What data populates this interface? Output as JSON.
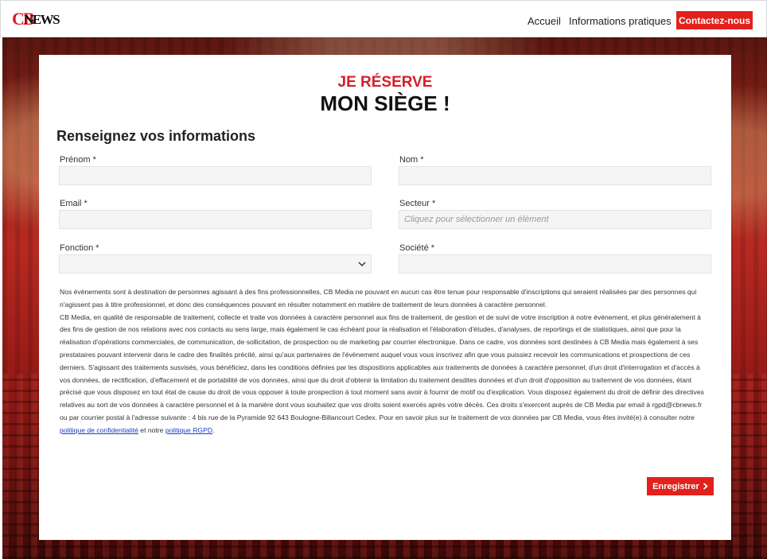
{
  "header": {
    "logo_cb": "CB",
    "logo_news": "NEWS",
    "nav": [
      {
        "label": "Accueil"
      },
      {
        "label": "Informations pratiques"
      }
    ],
    "contact_label": "Contactez-nous"
  },
  "hero": {
    "title_line1": "JE RÉSERVE",
    "title_line2": "MON SIÈGE !"
  },
  "form": {
    "section_title": "Renseignez vos informations",
    "prenom_label": "Prénom *",
    "nom_label": "Nom *",
    "email_label": "Email *",
    "secteur_label": "Secteur *",
    "secteur_placeholder": "Cliquez pour sélectionner un élément",
    "fonction_label": "Fonction *",
    "societe_label": "Société *"
  },
  "legal": {
    "p1": "Nos évènements sont à destination de personnes agissant à des fins professionnelles, CB Media ne pouvant en aucun cas être tenue pour responsable d'inscriptions qui seraient réalisées par des personnes qui n'agissent pas à titre professionnel, et donc des conséquences pouvant en résulter notamment en matière de traitement de leurs données à caractère personnel.",
    "p2": "CB Media, en qualité de responsable de traitement, collecte et traite vos données à caractère personnel aux fins de traitement, de gestion et de suivi de votre inscription à notre évènement, et plus généralement à des fins de gestion de nos relations avec nos contacts au sens large, mais également le cas échéant pour la réalisation et l'élaboration d'études, d'analyses, de reportings et de statistiques, ainsi que pour la réalisation d'opérations commerciales, de communication, de sollicitation, de prospection ou de marketing par courrier électronique. Dans ce cadre, vos données sont destinées à CB Media mais également à ses prestataires pouvant intervenir dans le cadre des finalités précité, ainsi qu'aux partenaires de l'évènement auquel vous vous inscrivez afin que vous puissiez recevoir les communications et prospections de ces derniers. S'agissant des traitements susvisés, vous bénéficiez, dans les conditions définies par les dispositions applicables aux traitements de données à caractère personnel, d'un droit d'interrogation et d'accès à vos données, de rectification, d'effacement et de portabilité de vos données, ainsi que du droit d'obtenir la limitation du traitement desdites données et d'un droit d'opposition au traitement de vos données, étant précisé que vous disposez en tout état de cause du droit de vous opposer à toute prospection à tout moment sans avoir à fournir de motif ou d'explication. Vous disposez également du droit de définir des directives relatives au sort de vos données à caractère personnel et à la manière dont vous souhaitez que vos droits soient exercés après votre décès. Ces droits s'exercent auprès de CB Media par email à rgpd@cbnews.fr ou par courrier postal à l'adresse suivante : 4 bis rue de la Pyramide 92 643 Boulogne-Billancourt Cedex. Pour en savoir plus sur le traitement de vos données par CB Media, vous êtes invité(e) à consulter notre",
    "link_privacy": "politique de confidentialité",
    "and_text": " et notre ",
    "link_rgpd": "politique RGPD",
    "end_text": "."
  },
  "submit": {
    "label": "Enregistrer"
  },
  "colors": {
    "accent": "#e2211c",
    "brand_red": "#d71e28",
    "link": "#1a3dbf"
  }
}
